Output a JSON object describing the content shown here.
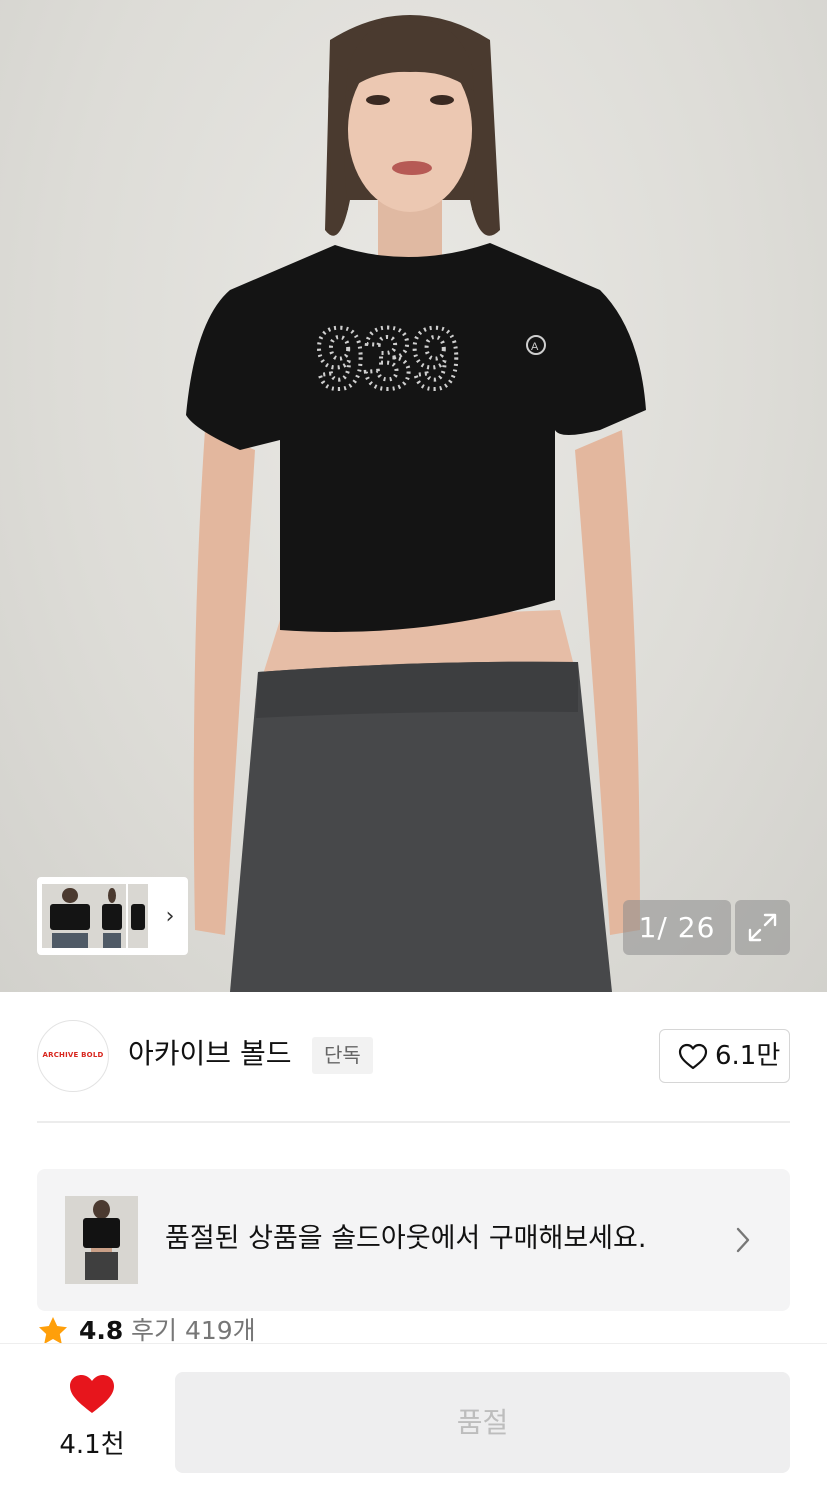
{
  "gallery": {
    "counter": "1/ 26",
    "expand_icon": "expand-arrows-icon",
    "thumbnail_next_icon": "chevron-right-icon",
    "print_text": "939",
    "print_mark": "A"
  },
  "brand": {
    "logo_text": "ARCHIVE BOLD",
    "name": "아카이브 볼드",
    "badge": "단독",
    "like_count": "6.1만"
  },
  "soldout_banner": {
    "text": "품절된 상품을 솔드아웃에서 구매해보세요."
  },
  "rating": {
    "score": "4.8",
    "reviews": "후기 419개"
  },
  "bottom_bar": {
    "like_count": "4.1천",
    "buy_button_label": "품절"
  },
  "colors": {
    "heart_red": "#e7151c",
    "star_orange": "#ff9f0a",
    "logo_red": "#d8261e",
    "disabled_button": "#eeeeef"
  }
}
